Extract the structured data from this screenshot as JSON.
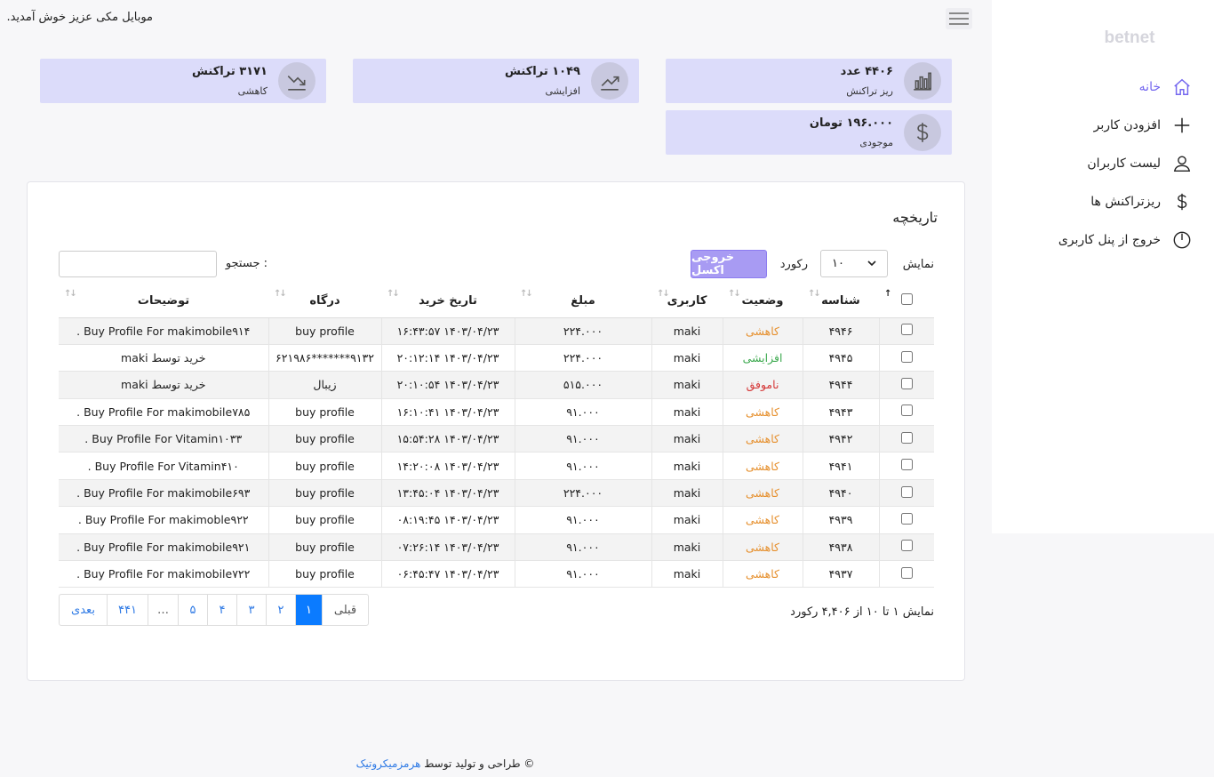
{
  "topbar": {
    "welcome": "موبایل مکی عزیز خوش آمدید."
  },
  "sidebar": {
    "brand": "betnet",
    "items": [
      {
        "label": "خانه"
      },
      {
        "label": "افزودن کاربر"
      },
      {
        "label": "لیست کاربران"
      },
      {
        "label": "ریزتراکنش ها"
      },
      {
        "label": "خروج از پنل کاربری"
      }
    ]
  },
  "cards": {
    "c1": {
      "value": "۴۴۰۶ عدد",
      "label": "ریز تراکنش"
    },
    "c2": {
      "value": "۱۰۴۹ تراکنش",
      "label": "افزایشی"
    },
    "c3": {
      "value": "۳۱۷۱ تراکنش",
      "label": "کاهشی"
    },
    "c4": {
      "value": "۱۹۶.۰۰۰ تومان",
      "label": "موجودی"
    }
  },
  "panel": {
    "title": "تاریخچه",
    "show_label": "نمایش",
    "page_size": "۱۰",
    "records_label": "رکورد",
    "excel_button": "خروجی اکسل",
    "search_label": "جستجو :",
    "search_value": ""
  },
  "table": {
    "headers": [
      "شناسه",
      "وضعیت",
      "کاربری",
      "مبلغ",
      "تاریخ خرید",
      "درگاه",
      "توضیحات"
    ],
    "rows": [
      [
        "۴۹۴۶",
        "کاهشی",
        "maki",
        "۲۲۴.۰۰۰",
        "۱۴۰۳/۰۴/۲۳ ۱۶:۴۳:۵۷",
        "buy profile",
        "Buy Profile For makimobile۹۱۴ ."
      ],
      [
        "۴۹۴۵",
        "افزایشی",
        "maki",
        "۲۲۴.۰۰۰",
        "۱۴۰۳/۰۴/۲۳ ۲۰:۱۲:۱۴",
        "۹۱۳۲*******۶۲۱۹۸۶",
        "خرید توسط maki"
      ],
      [
        "۴۹۴۴",
        "ناموفق",
        "maki",
        "۵۱۵.۰۰۰",
        "۱۴۰۳/۰۴/۲۳ ۲۰:۱۰:۵۴",
        "زیبال",
        "خرید توسط maki"
      ],
      [
        "۴۹۴۳",
        "کاهشی",
        "maki",
        "۹۱.۰۰۰",
        "۱۴۰۳/۰۴/۲۳ ۱۶:۱۰:۴۱",
        "buy profile",
        "Buy Profile For makimobile۷۸۵ ."
      ],
      [
        "۴۹۴۲",
        "کاهشی",
        "maki",
        "۹۱.۰۰۰",
        "۱۴۰۳/۰۴/۲۳ ۱۵:۵۴:۲۸",
        "buy profile",
        "Buy Profile For Vitamin۱۰۳۳ ."
      ],
      [
        "۴۹۴۱",
        "کاهشی",
        "maki",
        "۹۱.۰۰۰",
        "۱۴۰۳/۰۴/۲۳ ۱۴:۲۰:۰۸",
        "buy profile",
        "Buy Profile For Vitamin۴۱۰ ."
      ],
      [
        "۴۹۴۰",
        "کاهشی",
        "maki",
        "۲۲۴.۰۰۰",
        "۱۴۰۳/۰۴/۲۳ ۱۳:۴۵:۰۴",
        "buy profile",
        "Buy Profile For makimobile۶۹۳ ."
      ],
      [
        "۴۹۳۹",
        "کاهشی",
        "maki",
        "۹۱.۰۰۰",
        "۱۴۰۳/۰۴/۲۳ ۰۸:۱۹:۴۵",
        "buy profile",
        "Buy Profile For makimoble۹۲۲ ."
      ],
      [
        "۴۹۳۸",
        "کاهشی",
        "maki",
        "۹۱.۰۰۰",
        "۱۴۰۳/۰۴/۲۳ ۰۷:۲۶:۱۴",
        "buy profile",
        "Buy Profile For makimobile۹۲۱ ."
      ],
      [
        "۴۹۳۷",
        "کاهشی",
        "maki",
        "۹۱.۰۰۰",
        "۱۴۰۳/۰۴/۲۳ ۰۶:۴۵:۴۷",
        "buy profile",
        "Buy Profile For makimobile۷۲۲ ."
      ]
    ]
  },
  "pagination": {
    "prev": "قبلی",
    "pages": [
      "۱",
      "۲",
      "۳",
      "۴",
      "۵",
      "…",
      "۴۴۱"
    ],
    "next": "بعدی",
    "info": "نمایش ۱ تا ۱۰ از ۴,۴۰۶ رکورد"
  },
  "footer": {
    "text": "© طراحی و تولید توسط",
    "link": "هرمزمیکروتیک"
  },
  "colors": {
    "accent": "#7467ef",
    "card_bg": "#dcdcfa",
    "active_page": "#0b7bff",
    "decrease": "#e6902e",
    "increase": "#3eaa50",
    "fail": "#d53a3a"
  }
}
